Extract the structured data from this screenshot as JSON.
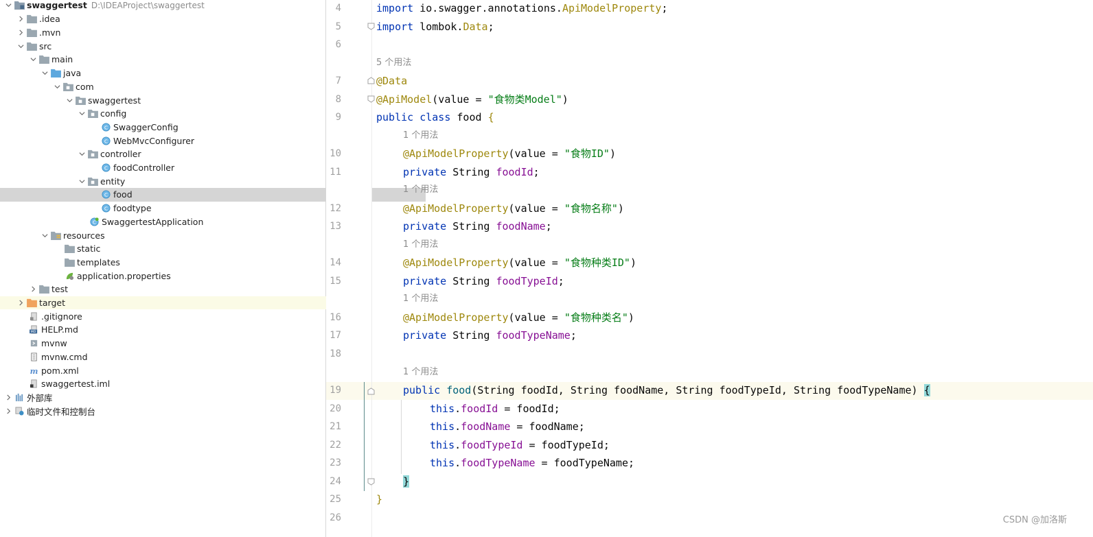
{
  "project_tree": {
    "root_label": "swaggertest",
    "root_path": "D:\\IDEAProject\\swaggertest",
    "items": [
      {
        "label": ".idea"
      },
      {
        "label": ".mvn"
      },
      {
        "label": "src"
      },
      {
        "label": "main"
      },
      {
        "label": "java"
      },
      {
        "label": "com"
      },
      {
        "label": "swaggertest"
      },
      {
        "label": "config"
      },
      {
        "label": "SwaggerConfig"
      },
      {
        "label": "WebMvcConfigurer"
      },
      {
        "label": "controller"
      },
      {
        "label": "foodController"
      },
      {
        "label": "entity"
      },
      {
        "label": "food"
      },
      {
        "label": "foodtype"
      },
      {
        "label": "SwaggertestApplication"
      },
      {
        "label": "resources"
      },
      {
        "label": "static"
      },
      {
        "label": "templates"
      },
      {
        "label": "application.properties"
      },
      {
        "label": "test"
      },
      {
        "label": "target"
      },
      {
        "label": ".gitignore"
      },
      {
        "label": "HELP.md"
      },
      {
        "label": "mvnw"
      },
      {
        "label": "mvnw.cmd"
      },
      {
        "label": "pom.xml"
      },
      {
        "label": "swaggertest.iml"
      },
      {
        "label": "外部库"
      },
      {
        "label": "临时文件和控制台"
      }
    ]
  },
  "editor": {
    "line_numbers": [
      "4",
      "5",
      "6",
      "7",
      "8",
      "9",
      "10",
      "11",
      "12",
      "13",
      "14",
      "15",
      "16",
      "17",
      "18",
      "19",
      "20",
      "21",
      "22",
      "23",
      "24",
      "25",
      "26"
    ],
    "usage_hints": [
      "5 个用法",
      "1 个用法",
      "1 个用法",
      "1 个用法",
      "1 个用法",
      "1 个用法"
    ],
    "code": {
      "l4": {
        "t1": "import",
        "t2": " io.swagger.annotations.",
        "t3": "ApiModelProperty",
        "t4": ";"
      },
      "l5": {
        "t1": "import",
        "t2": " lombok.",
        "t3": "Data",
        "t4": ";"
      },
      "l7": {
        "t1": "@Data"
      },
      "l8": {
        "t1": "@ApiModel",
        "t2": "(value = ",
        "t3": "\"食物类Model\"",
        "t4": ")"
      },
      "l9": {
        "t1": "public class",
        "t2": " food ",
        "t3": "{"
      },
      "l10": {
        "t1": "@ApiModelProperty",
        "t2": "(value = ",
        "t3": "\"食物ID\"",
        "t4": ")"
      },
      "l11": {
        "t1": "private",
        "t2": " String ",
        "t3": "foodId",
        "t4": ";"
      },
      "l12": {
        "t1": "@ApiModelProperty",
        "t2": "(value = ",
        "t3": "\"食物名称\"",
        "t4": ")"
      },
      "l13": {
        "t1": "private",
        "t2": " String ",
        "t3": "foodName",
        "t4": ";"
      },
      "l14": {
        "t1": "@ApiModelProperty",
        "t2": "(value = ",
        "t3": "\"食物种类ID\"",
        "t4": ")"
      },
      "l15": {
        "t1": "private",
        "t2": " String ",
        "t3": "foodTypeId",
        "t4": ";"
      },
      "l16": {
        "t1": "@ApiModelProperty",
        "t2": "(value = ",
        "t3": "\"食物种类名\"",
        "t4": ")"
      },
      "l17": {
        "t1": "private",
        "t2": " String ",
        "t3": "foodTypeName",
        "t4": ";"
      },
      "l19": {
        "t1": "public",
        "t2": " ",
        "t3": "food",
        "t4": "(String foodId, String foodName, String foodTypeId, String foodTypeName) ",
        "t5": "{"
      },
      "l20": {
        "t1": "this",
        "t2": ".",
        "t3": "foodId",
        "t4": " = foodId;"
      },
      "l21": {
        "t1": "this",
        "t2": ".",
        "t3": "foodName",
        "t4": " = foodName;"
      },
      "l22": {
        "t1": "this",
        "t2": ".",
        "t3": "foodTypeId",
        "t4": " = foodTypeId;"
      },
      "l23": {
        "t1": "this",
        "t2": ".",
        "t3": "foodTypeName",
        "t4": " = foodTypeName;"
      },
      "l24": {
        "t1": "}"
      },
      "l25": {
        "t1": "}"
      }
    }
  },
  "watermark": "CSDN @加洛斯",
  "colors": {
    "keyword": "#0033b3",
    "annotation": "#9e880d",
    "string": "#067d17",
    "field": "#871094",
    "selection": "#d5d5d5"
  }
}
